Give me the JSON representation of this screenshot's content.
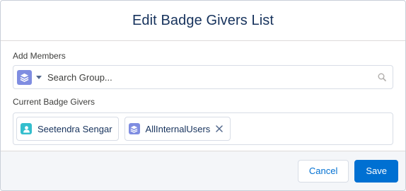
{
  "modal": {
    "title": "Edit Badge Givers List"
  },
  "add_members": {
    "label": "Add Members",
    "search": {
      "placeholder": "Search Group...",
      "value": "",
      "entity_icon": "group-icon",
      "caret_icon": "chevron-down-icon",
      "search_icon": "search-icon"
    }
  },
  "current_givers": {
    "label": "Current Badge Givers",
    "pills": [
      {
        "label": "Seetendra Sengar",
        "icon": "user-icon",
        "icon_color": "#34becd",
        "removable": false
      },
      {
        "label": "AllInternalUsers",
        "icon": "group-icon",
        "icon_color": "#7f8de1",
        "removable": true
      }
    ]
  },
  "footer": {
    "cancel_label": "Cancel",
    "save_label": "Save"
  },
  "colors": {
    "brand": "#0070d2",
    "text": "#16325c",
    "group_icon": "#7f8de1",
    "user_icon": "#34becd"
  }
}
